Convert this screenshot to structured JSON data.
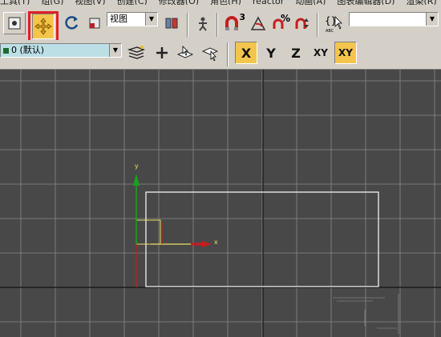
{
  "menubar": {
    "items": [
      "工具(T)",
      "组(G)",
      "视图(V)",
      "创建(C)",
      "修改器(O)",
      "角色(H)",
      "reactor",
      "动画(A)",
      "图表编辑器(D)",
      "渲染(R)"
    ]
  },
  "toolbar": {
    "reference_coord_combo": "视图",
    "named_selection_combo": "",
    "snap_angle_label": "3",
    "percent_snap_label": "%"
  },
  "layer_toolbar": {
    "current_layer": "0 (默认)",
    "axis_buttons": [
      "X",
      "Y",
      "Z",
      "XY",
      "XY"
    ]
  },
  "viewport": {
    "gizmo_x_label": "x",
    "gizmo_y_label": "y"
  },
  "colors": {
    "highlight": "#e02020",
    "active_button": "#f3c54d",
    "viewport_bg": "#484848",
    "grid_line": "#8a8a8a",
    "axis_line": "#111111",
    "gizmo_x": "#cc1a1a",
    "gizmo_y": "#1aa31a",
    "gizmo_xy_plane": "#e8e060"
  }
}
